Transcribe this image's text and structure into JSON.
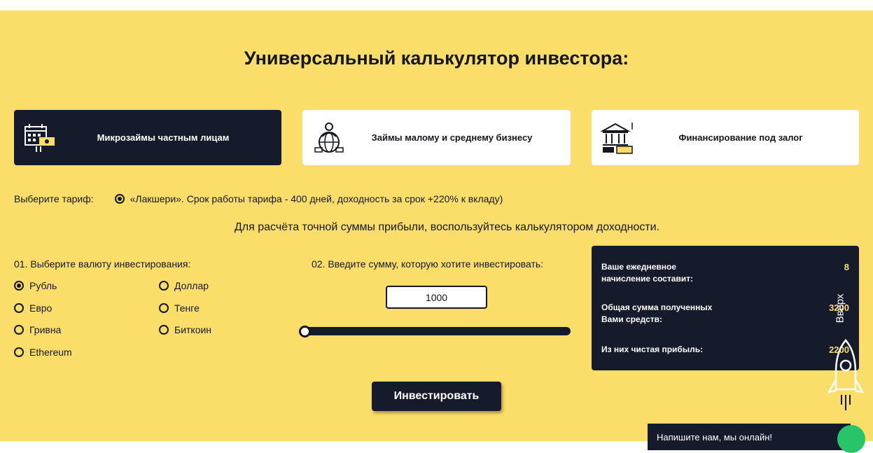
{
  "page": {
    "title": "Универсальный калькулятор инвестора:"
  },
  "categories": [
    {
      "label": "Микрозаймы частным лицам",
      "active": true,
      "icon": "calendar-money-icon"
    },
    {
      "label": "Займы малому и среднему бизнесу",
      "active": false,
      "icon": "business-globe-icon"
    },
    {
      "label": "Финансирование под залог",
      "active": false,
      "icon": "bank-building-icon"
    }
  ],
  "tariff": {
    "label": "Выберите тариф:",
    "option": "«Лакшери». Срок работы тарифа - 400 дней, доходность за срок +220% к вкладу)",
    "selected": true
  },
  "hint": "Для расчёта точной суммы прибыли, воспользуйтесь калькулятором доходности.",
  "currency": {
    "title": "01. Выберите валюту инвестирования:",
    "options": [
      {
        "label": "Рубль",
        "checked": true
      },
      {
        "label": "Доллар",
        "checked": false
      },
      {
        "label": "Евро",
        "checked": false
      },
      {
        "label": "Тенге",
        "checked": false
      },
      {
        "label": "Гривна",
        "checked": false
      },
      {
        "label": "Биткоин",
        "checked": false
      },
      {
        "label": "Ethereum",
        "checked": false
      }
    ]
  },
  "amount": {
    "title": "02. Введите сумму, которую хотите инвестировать:",
    "value": "1000",
    "slider_fraction": 0.0
  },
  "results": {
    "daily_label": "Ваше ежедневное начисление составит:",
    "daily_value": "8",
    "total_label": "Общая сумма полученных Вами средств:",
    "total_value": "3200",
    "profit_label": "Из них чистая прибыль:",
    "profit_value": "2200"
  },
  "actions": {
    "invest_label": "Инвестировать",
    "scroll_up_label": "Вверх"
  },
  "chat": {
    "label": "Напишите нам, мы онлайн!"
  },
  "colors": {
    "accent": "#fbdd6a",
    "dark": "#161b2b",
    "online": "#27c46a"
  }
}
